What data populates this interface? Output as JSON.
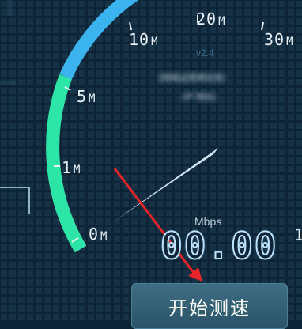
{
  "gauge": {
    "ticks": [
      {
        "value": "0",
        "unit": "M"
      },
      {
        "value": "1",
        "unit": "M"
      },
      {
        "value": "5",
        "unit": "M"
      },
      {
        "value": "10",
        "unit": "M"
      },
      {
        "value": "20",
        "unit": "M"
      },
      {
        "value": "30",
        "unit": "M"
      }
    ],
    "colors": {
      "low_arc": "#2ee5a8",
      "high_arc": "#3ab3ee",
      "needle": "#cde7ff",
      "annotation_arrow": "#e8262a"
    }
  },
  "version": "v2.4",
  "info_lines": [
    "(网络运营商信息)",
    "(IP 地址)"
  ],
  "speed": {
    "unit": "Mbps",
    "value": "00.00"
  },
  "start_button_label": "开始测速",
  "edge_mark": "1"
}
